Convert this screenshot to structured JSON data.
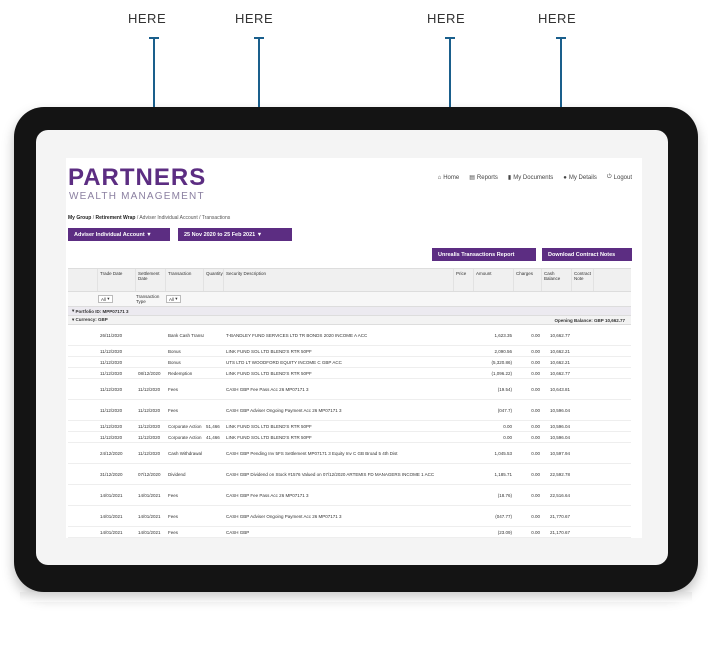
{
  "callouts": {
    "label": "HERE"
  },
  "header": {
    "logo_main": "PARTNERS",
    "logo_sub": "WEALTH MANAGEMENT",
    "nav": [
      "Home",
      "Reports",
      "My Documents",
      "My Details",
      "Logout"
    ]
  },
  "breadcrumb": {
    "first": "My Group",
    "second": "Retirement Wrap",
    "third": "Adviser Individual Account",
    "fourth": "Transactions"
  },
  "controls": {
    "account_dropdown": "Adviser Individual Account",
    "date_range": "25 Nov 2020 to 25 Feb 2021",
    "unrealised_button": "Unrealis Transactions Report",
    "download_button": "Download Contract Notes"
  },
  "table": {
    "headers": [
      "Trade Date",
      "Settlement Date",
      "Transaction",
      "Quantity",
      "Security Description",
      "Price",
      "Amount",
      "Charges",
      "Cash Balance",
      "Contract Note"
    ],
    "filters": {
      "trade_date": "All",
      "transaction_type_label": "Transaction Type",
      "transaction_type": "All"
    },
    "portfolio_label": "Portfolio ID: MPP07171 3",
    "currency_label": "Currency: GBP",
    "opening_balance": "Opening Balance: GBP 10,662.77",
    "rows": [
      {
        "d1": "26/11/2020",
        "d2": "",
        "t": "Bank Cash Transaction",
        "q": "",
        "desc": "T-BANDLEY FUND SERVICES LTD TR BONDS 2020 INCOME A ACC",
        "p": "",
        "amt": "1,623.35",
        "ch": "0.00",
        "bal": "10,662.77",
        "tall": true
      },
      {
        "d1": "11/12/2020",
        "d2": "",
        "t": "Bonus",
        "q": "",
        "desc": "LINK FUND SOL LTD BLEND'S RTR 50PF",
        "p": "",
        "amt": "2,090.56",
        "ch": "0.00",
        "bal": "10,662.21",
        "tall": false
      },
      {
        "d1": "11/12/2020",
        "d2": "",
        "t": "Bonus",
        "q": "",
        "desc": "UTS LTD LT WOODFORD EQUITY INCOME C GBP ACC",
        "p": "",
        "amt": "(5,320.86)",
        "ch": "0.00",
        "bal": "10,662.21",
        "tall": false
      },
      {
        "d1": "11/12/2020",
        "d2": "08/12/2020",
        "t": "Redemption",
        "q": "",
        "desc": "LINK FUND SOL LTD BLEND'S RTR 50PF",
        "p": "",
        "amt": "(1,096.22)",
        "ch": "0.00",
        "bal": "10,662.77",
        "tall": false
      },
      {
        "d1": "11/12/2020",
        "d2": "11/12/2020",
        "t": "Fees",
        "q": "",
        "desc": "CASH GBP Fee Pass Acc 26 MP07171 3",
        "p": "",
        "amt": "(19.54)",
        "ch": "0.00",
        "bal": "10,643.81",
        "tall": true
      },
      {
        "d1": "11/12/2020",
        "d2": "11/12/2020",
        "t": "Fees",
        "q": "",
        "desc": "CASH GBP Adviser Ongoing Payment Acc 26 MP07171 3",
        "p": "",
        "amt": "(047.7)",
        "ch": "0.00",
        "bal": "10,596.04",
        "tall": true
      },
      {
        "d1": "11/12/2020",
        "d2": "11/12/2020",
        "t": "Corporate Action",
        "q": "51,466",
        "desc": "LINK FUND SOL LTD BLEND'S RTR 50PF",
        "p": "",
        "amt": "0.00",
        "ch": "0.00",
        "bal": "10,596.04",
        "tall": false
      },
      {
        "d1": "11/12/2020",
        "d2": "11/12/2020",
        "t": "Corporate Action",
        "q": "41,466",
        "desc": "LINK FUND SOL LTD BLEND'S RTR 50PF",
        "p": "",
        "amt": "0.00",
        "ch": "0.00",
        "bal": "10,596.04",
        "tall": false
      },
      {
        "d1": "24/12/2020",
        "d2": "11/12/2020",
        "t": "Cash Withdrawal",
        "q": "",
        "desc": "CASH GBP Pending Inv 5FS Settlement MP07171 3 Equity Inv C GB Broad 5 4th Dist",
        "p": "",
        "amt": "1,045.53",
        "ch": "0.00",
        "bal": "10,597.94",
        "tall": true
      },
      {
        "d1": "31/12/2020",
        "d2": "07/12/2020",
        "t": "Dividend",
        "q": "",
        "desc": "CASH GBP Dividend on Stock #1576 Valued on 07/12/2020 ARTEMIS FD MANAGERS INCOME 1 ACC",
        "p": "",
        "amt": "1,185.71",
        "ch": "0.00",
        "bal": "22,592.78",
        "tall": true
      },
      {
        "d1": "14/01/2021",
        "d2": "14/01/2021",
        "t": "Fees",
        "q": "",
        "desc": "CASH GBP Fee Pass Acc 26 MP07171 3",
        "p": "",
        "amt": "(18.76)",
        "ch": "0.00",
        "bal": "22,516.64",
        "tall": true
      },
      {
        "d1": "14/01/2021",
        "d2": "14/01/2021",
        "t": "Fees",
        "q": "",
        "desc": "CASH GBP Adviser Ongoing Payment Acc 26 MP07171 3",
        "p": "",
        "amt": "(047.77)",
        "ch": "0.00",
        "bal": "21,770.67",
        "tall": true
      },
      {
        "d1": "14/01/2021",
        "d2": "14/01/2021",
        "t": "Fees",
        "q": "",
        "desc": "CASH GBP",
        "p": "",
        "amt": "(23.09)",
        "ch": "0.00",
        "bal": "21,170.67",
        "tall": false
      }
    ]
  },
  "colors": {
    "brand": "#5c2d82",
    "callout": "#1a5f8c",
    "device": "#141414"
  }
}
